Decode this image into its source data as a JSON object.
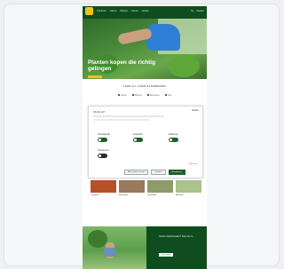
{
  "site": {
    "header": {
      "nav_items": [
        "Tuinieren",
        "Gazon",
        "Planten",
        "Kamer",
        "Advies"
      ],
      "util_items": [
        "NL",
        "Zoeken"
      ]
    },
    "hero": {
      "title": "Planten kopen die richtig gelingen",
      "cta_label": ""
    },
    "strip": {
      "title": "LEER ALL OVER GAZONPADEN",
      "links": [
        "Gazon",
        "Planten",
        "Bemesten",
        "Tuin"
      ]
    },
    "cookie_modal": {
      "title": "Wij zijn ok?",
      "close_label": "Sluiten",
      "options": [
        {
          "label": "Noodzakelijk",
          "state": "on"
        },
        {
          "label": "Analytisch",
          "state": "on"
        },
        {
          "label": "Marketing",
          "state": "on"
        },
        {
          "label": "Voorkeuren",
          "state": "off"
        }
      ],
      "hint": "Meer info",
      "buttons": [
        "Alle cookies accept.",
        "Opslaan",
        "Accepteren"
      ]
    },
    "thumbnails": [
      {
        "caption": "Tuinplant",
        "color": "#b6502a"
      },
      {
        "caption": "Bestrating",
        "color": "#9a7a5e"
      },
      {
        "caption": "Gazonpad",
        "color": "#8f9a6a"
      },
      {
        "caption": "Bloemen",
        "color": "#a9c38a"
      }
    ],
    "promo": {
      "text": "Gazon onderhouden? Doe het zo",
      "button": "Lees meer"
    }
  },
  "colors": {
    "brand_green": "#0f4d1f",
    "accent_yellow": "#f2c21a"
  }
}
